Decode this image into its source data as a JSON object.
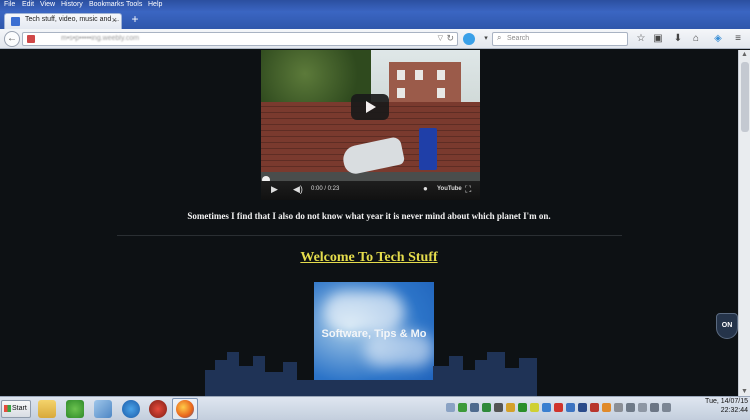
{
  "menu": [
    "File",
    "Edit",
    "View",
    "History",
    "Bookmarks",
    "Tools",
    "Help"
  ],
  "tab": {
    "title": "Tech stuff, video, music and ...",
    "close": "×"
  },
  "newtab": "+",
  "nav": {
    "url": "m•s•p•••••ing.weebly.com",
    "search_placeholder": "Search",
    "back": "←"
  },
  "video": {
    "time": "0:00 / 0:23",
    "brand": "YouTube"
  },
  "page": {
    "caption": "Sometimes I find that I also do not know what year it is never mind about which planet I'm on.",
    "welcome": "Welcome To Tech Stuff",
    "promo_text": "Software, Tips & Mo"
  },
  "shield_label": "ON",
  "taskbar": {
    "start_label": "Start"
  },
  "clock": {
    "day": "Tue, 14/07/15",
    "time": "22:32:44"
  },
  "colors": {
    "heading": "#e4dc4c",
    "background": "#0d1114"
  }
}
